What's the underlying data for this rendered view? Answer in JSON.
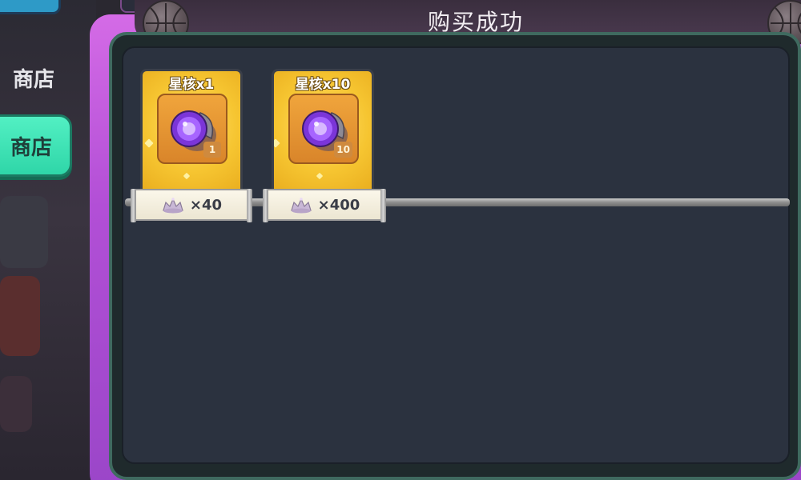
{
  "sidebar": {
    "tabs": [
      {
        "label": "商店",
        "active": false
      },
      {
        "label": "商店",
        "active": true
      }
    ]
  },
  "dialog": {
    "title": "购买成功"
  },
  "items": [
    {
      "name": "星核x1",
      "quantity_badge": "1",
      "price": "×40",
      "currency_icon": "star-crown-currency-icon"
    },
    {
      "name": "星核x10",
      "quantity_badge": "10",
      "price": "×400",
      "currency_icon": "star-crown-currency-icon"
    }
  ],
  "colors": {
    "active_tab": "#2fd6a8",
    "dialog_frame": "#b24fd6",
    "panel_bg": "#2b323f",
    "card_gold": "#f6c531",
    "orb_purple": "#8a3fe0"
  }
}
